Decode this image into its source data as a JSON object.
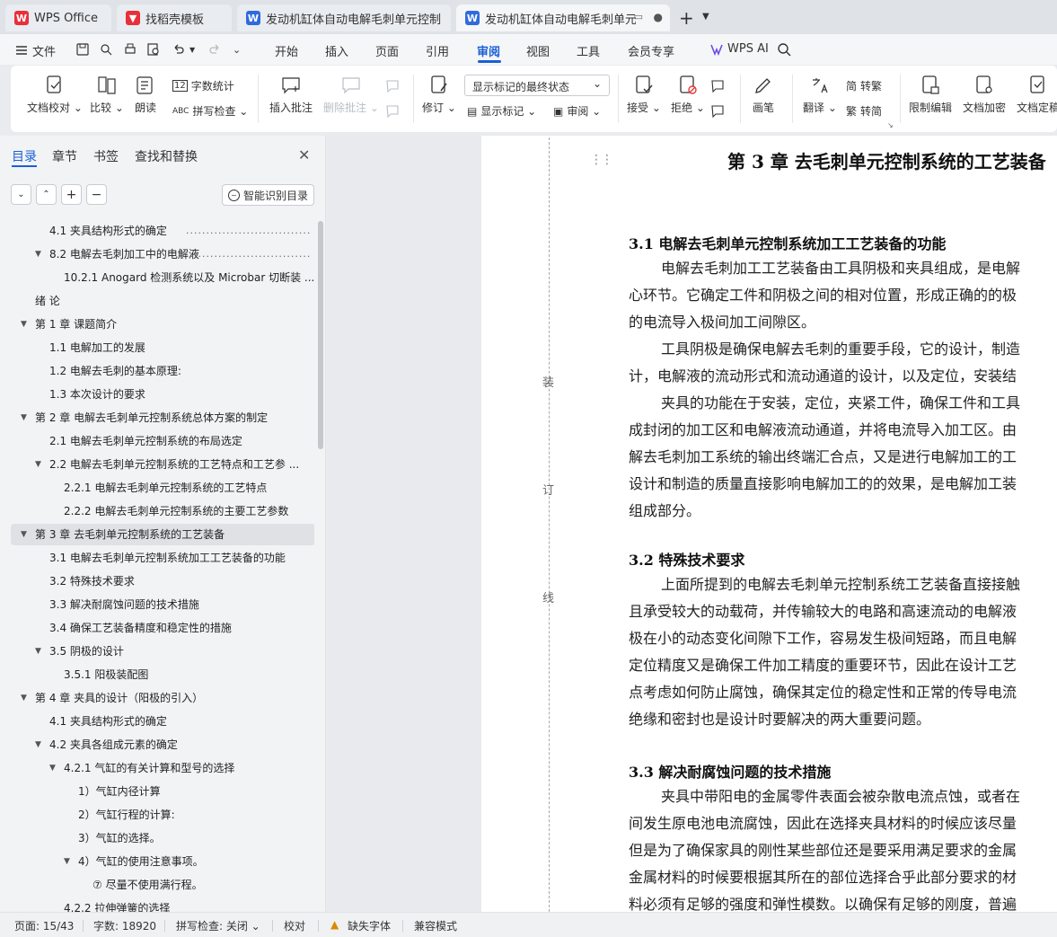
{
  "tabs": [
    {
      "label": "WPS Office",
      "icon": "wps-logo-icon"
    },
    {
      "label": "找稻壳模板",
      "icon": "docer-icon"
    },
    {
      "label": "发动机缸体自动电解毛刺单元控制系统",
      "icon": "word-doc-icon"
    },
    {
      "label": "发动机缸体自动电解毛刺单元",
      "icon": "word-doc-icon",
      "active": true
    }
  ],
  "menu": {
    "file": "文件",
    "items": [
      "开始",
      "插入",
      "页面",
      "引用",
      "审阅",
      "视图",
      "工具",
      "会员专享"
    ],
    "active": "审阅",
    "wps_ai": "WPS AI"
  },
  "ribbon": {
    "doc_proofread": "文档校对",
    "compare": "比较",
    "read_aloud": "朗读",
    "word_count": "字数统计",
    "spell_check": "拼写检查",
    "insert_comment": "插入批注",
    "delete_comment": "删除批注",
    "track_changes": "修订",
    "markup_display": "显示标记的最终状态",
    "show_markup": "显示标记",
    "review_pane": "审阅",
    "accept": "接受",
    "reject": "拒绝",
    "ink": "画笔",
    "translate": "翻译",
    "to_traditional": "转繁",
    "to_simplified": "转简",
    "restrict_edit": "限制编辑",
    "doc_encrypt": "文档加密",
    "doc_finalize": "文档定稿"
  },
  "nav_panel": {
    "tabs": [
      "目录",
      "章节",
      "书签",
      "查找和替换"
    ],
    "active_tab": "目录",
    "smart_toc": "智能识别目录",
    "toc": [
      {
        "text": "4.1  夹具结构形式的确定",
        "dots": "........................................",
        "level": 2
      },
      {
        "text": "8.2  电解去毛刺加工中的电解液",
        "dots": "...................................",
        "level": 2,
        "expander": true
      },
      {
        "text": "10.2.1 Anogard 检测系统以及 Microbar 切断装 ...",
        "level": 3
      },
      {
        "text": "绪  论",
        "level": 0
      },
      {
        "text": "第 1 章  课题简介",
        "level": 1,
        "expander": true
      },
      {
        "text": "1.1  电解加工的发展",
        "level": 2
      },
      {
        "text": "1.2  电解去毛刺的基本原理:",
        "level": 2
      },
      {
        "text": "1.3  本次设计的要求",
        "level": 2
      },
      {
        "text": "第 2 章  电解去毛刺单元控制系统总体方案的制定",
        "level": 1,
        "expander": true
      },
      {
        "text": "2.1  电解去毛刺单元控制系统的布局选定",
        "level": 2
      },
      {
        "text": "2.2    电解去毛刺单元控制系统的工艺特点和工艺参 ...",
        "level": 2,
        "expander": true
      },
      {
        "text": "2.2.1  电解去毛刺单元控制系统的工艺特点",
        "level": 3
      },
      {
        "text": "2.2.2  电解去毛刺单元控制系统的主要工艺参数",
        "level": 3
      },
      {
        "text": "第 3 章  去毛刺单元控制系统的工艺装备",
        "level": 1,
        "expander": true,
        "selected": true
      },
      {
        "text": "3.1  电解去毛刺单元控制系统加工工艺装备的功能",
        "level": 2
      },
      {
        "text": "3.2  特殊技术要求",
        "level": 2
      },
      {
        "text": "3.3  解决耐腐蚀问题的技术措施",
        "level": 2
      },
      {
        "text": "3.4  确保工艺装备精度和稳定性的措施",
        "level": 2
      },
      {
        "text": "3.5 阴极的设计",
        "level": 2,
        "expander": true
      },
      {
        "text": "3.5.1  阳极装配图",
        "level": 3
      },
      {
        "text": "第 4 章  夹具的设计（阳极的引入）",
        "level": 1,
        "expander": true
      },
      {
        "text": "4.1  夹具结构形式的确定",
        "level": 2
      },
      {
        "text": "4.2    夹具各组成元素的确定",
        "level": 2,
        "expander": true
      },
      {
        "text": "4.2.1  气缸的有关计算和型号的选择",
        "level": 3,
        "expander": true
      },
      {
        "text": "1）气缸内径计算",
        "level": 4
      },
      {
        "text": "2）气缸行程的计算:",
        "level": 4
      },
      {
        "text": "3）气缸的选择。",
        "level": 4
      },
      {
        "text": "4）气缸的使用注意事项。",
        "level": 4,
        "expander": true
      },
      {
        "text": "⑦  尽量不使用满行程。",
        "level": 5
      },
      {
        "text": "4.2.2  拉伸弹簧的选择",
        "level": 3
      }
    ]
  },
  "document": {
    "binding_chars": [
      "装",
      "订",
      "线"
    ],
    "chapter_title": "第 3 章  去毛刺单元控制系统的工艺装备",
    "sections": [
      {
        "heading": "3.1  电解去毛刺单元控制系统加工工艺装备的功能",
        "lines": [
          "电解去毛刺加工工艺装备由工具阴极和夹具组成，是电解",
          "心环节。它确定工件和阴极之间的相对位置，形成正确的的极",
          "的电流导入极间加工间隙区。",
          "工具阴极是确保电解去毛刺的重要手段，它的设计，制造",
          "计，电解液的流动形式和流动通道的设计，以及定位，安装结",
          "夹具的功能在于安装，定位，夹紧工件，确保工件和工具",
          "成封闭的加工区和电解液流动通道，并将电流导入加工区。由",
          "解去毛刺加工系统的输出终端汇合点，又是进行电解加工的工",
          "设计和制造的质量直接影响电解加工的的效果，是电解加工装",
          "组成部分。"
        ]
      },
      {
        "heading": "3.2  特殊技术要求",
        "lines": [
          "上面所提到的电解去毛刺单元控制系统工艺装备直接接触",
          "且承受较大的动载荷，并传输较大的电路和高速流动的电解液",
          "极在小的动态变化间隙下工作，容易发生极间短路，而且电解",
          "定位精度又是确保工件加工精度的重要环节，因此在设计工艺",
          "点考虑如何防止腐蚀，确保其定位的稳定性和正常的传导电流",
          "绝缘和密封也是设计时要解决的两大重要问题。"
        ]
      },
      {
        "heading": "3.3  解决耐腐蚀问题的技术措施",
        "lines": [
          "夹具中带阳电的金属零件表面会被杂散电流点蚀，或者在",
          "间发生原电池电流腐蚀，因此在选择夹具材料的时候应该尽量",
          "但是为了确保家具的刚性某些部位还是要采用满足要求的金属",
          "金属材料的时候要根据其所在的部位选择合乎此部分要求的材",
          "料必须有足够的强度和弹性模数。以确保有足够的刚度，普遍"
        ]
      }
    ]
  },
  "status": {
    "page": "页面: 15/43",
    "words": "字数: 18920",
    "spell": "拼写检查: 关闭",
    "proof": "校对",
    "missing_font": "缺失字体",
    "compat": "兼容模式"
  }
}
